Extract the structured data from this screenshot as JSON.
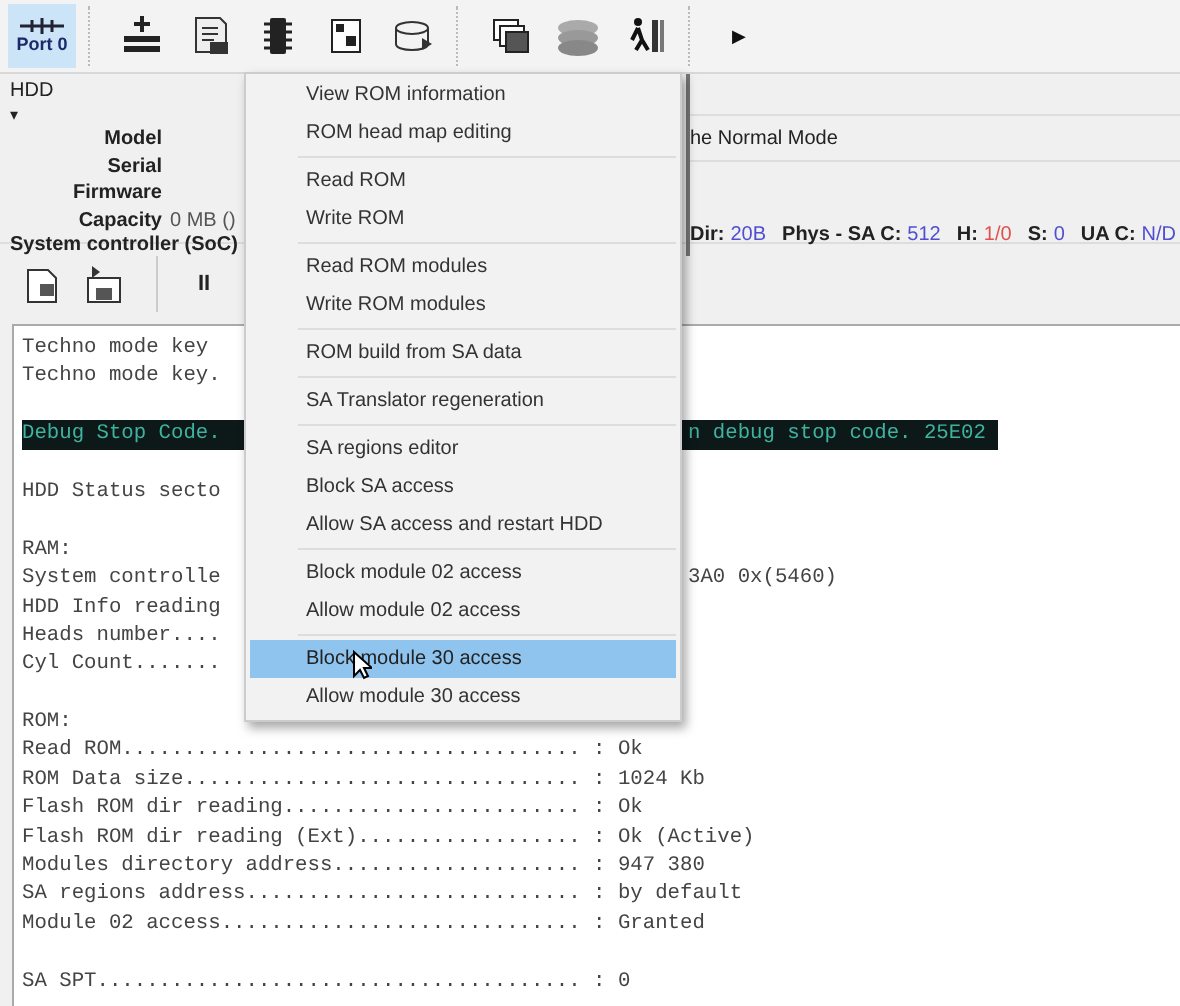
{
  "toolbar": {
    "port": {
      "label": "Port 0",
      "selected": true
    },
    "more": "▶"
  },
  "info": {
    "section": "HDD",
    "caret": "▾",
    "fields": [
      {
        "label": "Model"
      },
      {
        "label": "Serial"
      },
      {
        "label": "Firmware"
      },
      {
        "label": "Capacity",
        "value": "0 MB ()"
      }
    ],
    "mode": "he Normal Mode",
    "controller": "System controller (SoC)",
    "status": [
      {
        "label": "Dir:",
        "value": "20B",
        "color": "#4f4fd0"
      },
      {
        "label": "Phys - SA C:",
        "value": "512",
        "color": "#4f4fd0"
      },
      {
        "label": "H:",
        "value": "1/0",
        "color": "#e05050"
      },
      {
        "label": "S:",
        "value": "0",
        "color": "#4f4fd0"
      },
      {
        "label": "UA C:",
        "value": "N/D",
        "color": "#4f4fd0"
      }
    ]
  },
  "tools": {
    "pause": "II"
  },
  "console": [
    {
      "kind": "text",
      "left": "Techno mode key"
    },
    {
      "kind": "text",
      "left": "Techno mode key."
    },
    {
      "kind": "blank"
    },
    {
      "kind": "highlight",
      "left": "Debug Stop Code.",
      "right": "n debug stop code. 25E02"
    },
    {
      "kind": "blank"
    },
    {
      "kind": "text",
      "left": "HDD Status secto"
    },
    {
      "kind": "blank"
    },
    {
      "kind": "text",
      "left": "RAM:"
    },
    {
      "kind": "text",
      "left": "System controlle",
      "right": "3A0 0x(5460)"
    },
    {
      "kind": "text",
      "left": "HDD Info reading"
    },
    {
      "kind": "text",
      "left": "Heads number...."
    },
    {
      "kind": "text",
      "left": "Cyl Count......."
    },
    {
      "kind": "blank"
    },
    {
      "kind": "text",
      "left": "ROM:"
    },
    {
      "kind": "text",
      "left": "Read ROM..................................... : Ok"
    },
    {
      "kind": "text",
      "left": "ROM Data size................................ : 1024 Kb"
    },
    {
      "kind": "text",
      "left": "Flash ROM dir reading........................ : Ok"
    },
    {
      "kind": "text",
      "left": "Flash ROM dir reading (Ext).................. : Ok (Active)"
    },
    {
      "kind": "text",
      "left": "Modules directory address.................... : 947 380"
    },
    {
      "kind": "text",
      "left": "SA regions address........................... : by default"
    },
    {
      "kind": "text",
      "left": "Module 02 access............................. : Granted"
    },
    {
      "kind": "blank"
    },
    {
      "kind": "text",
      "left": "SA SPT....................................... : 0"
    }
  ],
  "menu": [
    [
      {
        "label": "View ROM information",
        "selected": false
      },
      {
        "label": "ROM head map editing",
        "selected": false
      }
    ],
    [
      {
        "label": "Read ROM",
        "selected": false
      },
      {
        "label": "Write ROM",
        "selected": false
      }
    ],
    [
      {
        "label": "Read ROM modules",
        "selected": false
      },
      {
        "label": "Write ROM modules",
        "selected": false
      }
    ],
    [
      {
        "label": "ROM build from SA data",
        "selected": false
      }
    ],
    [
      {
        "label": "SA Translator regeneration",
        "selected": false
      }
    ],
    [
      {
        "label": "SA regions editor",
        "selected": false
      },
      {
        "label": "Block SA access",
        "selected": false
      },
      {
        "label": "Allow SA access and restart HDD",
        "selected": false
      }
    ],
    [
      {
        "label": "Block module 02 access",
        "selected": false
      },
      {
        "label": "Allow module 02 access",
        "selected": false
      }
    ],
    [
      {
        "label": "Block module 30 access",
        "selected": true
      },
      {
        "label": "Allow module 30 access",
        "selected": false
      }
    ]
  ]
}
